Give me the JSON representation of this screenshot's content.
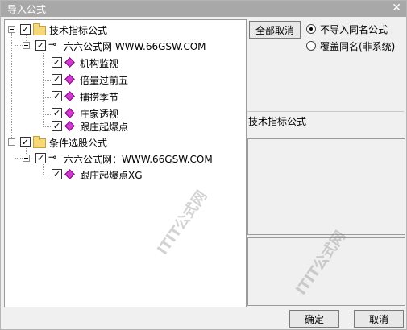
{
  "window": {
    "title": "导入公式",
    "close_glyph": "✕"
  },
  "tree": {
    "groups": [
      {
        "label": "技术指标公式",
        "checked": true,
        "children": [
          {
            "label": "六六公式网 WWW.66GSW.COM",
            "checked": true,
            "items": [
              {
                "label": "机构监视",
                "checked": true
              },
              {
                "label": "倍量过前五",
                "checked": true
              },
              {
                "label": "捕捞季节",
                "checked": true
              },
              {
                "label": "庄家透视",
                "checked": true
              },
              {
                "label": "跟庄起爆点",
                "checked": true
              }
            ]
          }
        ]
      },
      {
        "label": "条件选股公式",
        "checked": true,
        "children": [
          {
            "label": "六六公式网：WWW.66GSW.COM",
            "checked": true,
            "items": [
              {
                "label": "跟庄起爆点XG",
                "checked": true
              }
            ]
          }
        ]
      }
    ]
  },
  "right_panel": {
    "cancel_all_label": "全部取消",
    "radio_options": [
      {
        "label": "不导入同名公式",
        "selected": true
      },
      {
        "label": "覆盖同名(非系统)",
        "selected": false
      }
    ],
    "type_label": "技术指标公式"
  },
  "buttons": {
    "ok": "确定",
    "cancel": "取消"
  },
  "watermark": "ITIT公式网",
  "colors": {
    "title_bg": "#a8a8a8",
    "diamond": "#d13ad1",
    "folder": "#f5d978"
  }
}
